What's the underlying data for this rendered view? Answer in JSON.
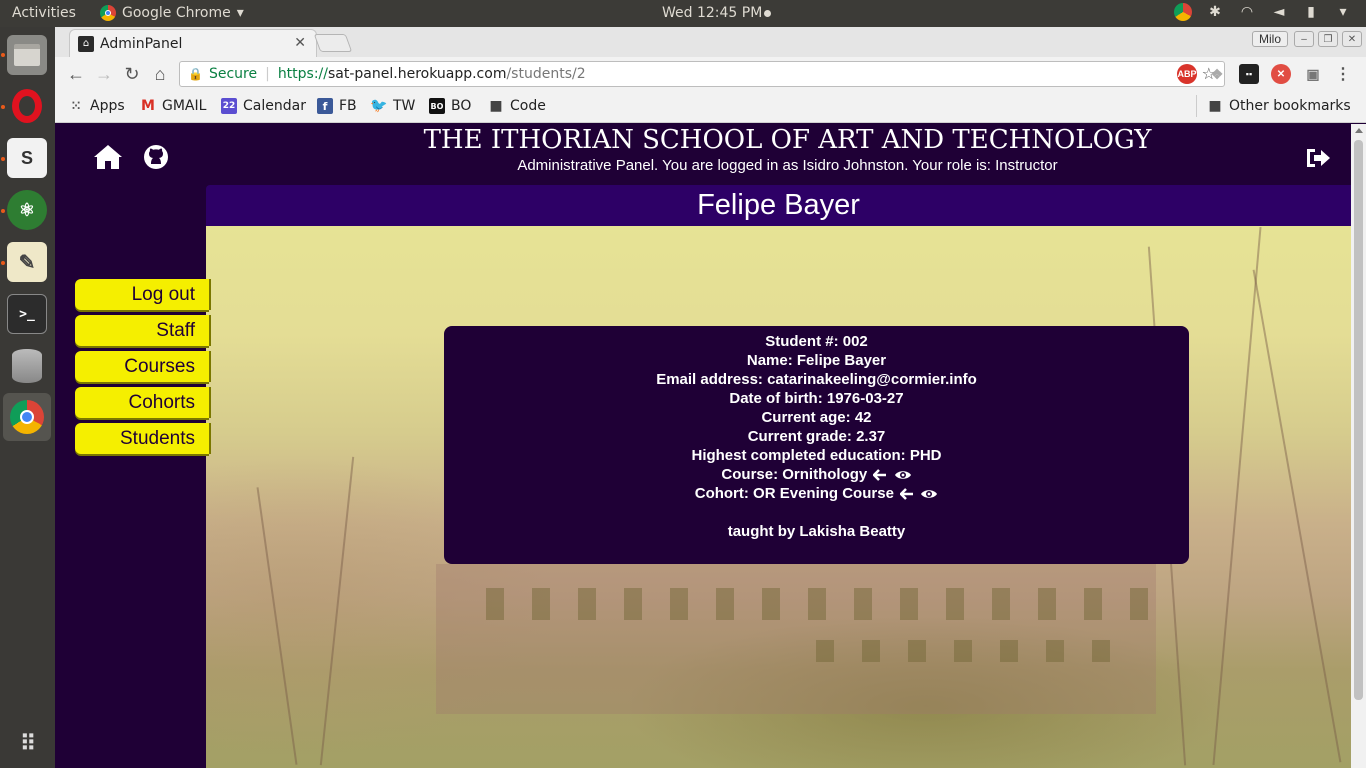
{
  "desktop": {
    "activities": "Activities",
    "app_name": "Google Chrome",
    "clock": "Wed 12:45 PM"
  },
  "browser": {
    "tab_title": "AdminPanel",
    "profile": "Milo",
    "url_secure": "Secure",
    "url_protocol": "https://",
    "url_host": "sat-panel.herokuapp.com",
    "url_path": "/students/2",
    "bookmarks": [
      "Apps",
      "GMAIL",
      "Calendar",
      "FB",
      "TW",
      "BO",
      "Code"
    ],
    "other_bookmarks": "Other bookmarks",
    "calendar_day": "22",
    "bo_badge": "BO",
    "abp_badge": "ABP"
  },
  "page": {
    "school_title": "THE ITHORIAN SCHOOL OF ART AND TECHNOLOGY",
    "subtitle": "Administrative Panel. You are logged in as Isidro Johnston. Your role is: Instructor",
    "student_name": "Felipe Bayer",
    "nav": [
      "Log out",
      "Staff",
      "Courses",
      "Cohorts",
      "Students"
    ],
    "card": {
      "student_number": "Student #: 002",
      "name": "Name: Felipe Bayer",
      "email": "Email address: catarinakeeling@cormier.info",
      "dob": "Date of birth: 1976-03-27",
      "age": "Current age: 42",
      "grade": "Current grade: 2.37",
      "education": "Highest completed education: PHD",
      "course": "Course: Ornithology",
      "cohort": "Cohort: OR Evening Course",
      "taught_by": "taught by Lakisha Beatty"
    }
  },
  "colors": {
    "page_bg": "#1f0036",
    "name_bar": "#2d0066",
    "nav_button": "#f5ef00"
  }
}
